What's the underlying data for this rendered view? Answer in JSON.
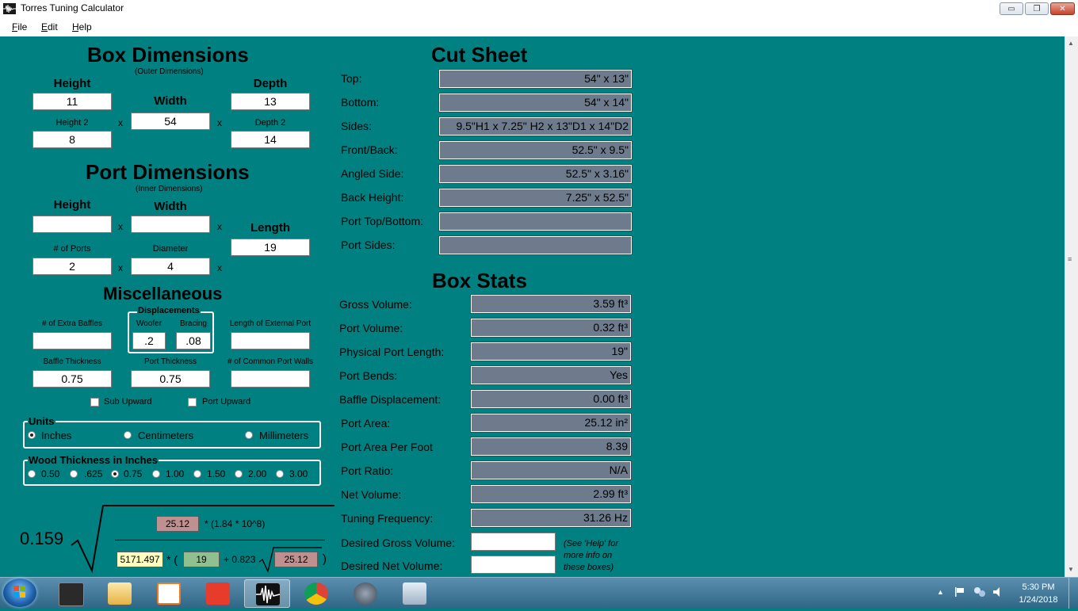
{
  "window": {
    "title": "Torres Tuning Calculator",
    "buttons": {
      "minimize": "▭",
      "maximize": "❐",
      "close": "✕"
    }
  },
  "menu": [
    {
      "label": "File"
    },
    {
      "label": "Edit"
    },
    {
      "label": "Help"
    }
  ],
  "box_dimensions": {
    "heading": "Box Dimensions",
    "subheading": "(Outer Dimensions)",
    "height_label": "Height",
    "height_value": "11",
    "width_label": "Width",
    "width_value": "54",
    "depth_label": "Depth",
    "depth_value": "13",
    "height2_label": "Height 2",
    "height2_value": "8",
    "depth2_label": "Depth 2",
    "depth2_value": "14",
    "times": "x"
  },
  "port_dimensions": {
    "heading": "Port Dimensions",
    "subheading": "(Inner Dimensions)",
    "height_label": "Height",
    "height_value": "",
    "width_label": "Width",
    "width_value": "",
    "length_label": "Length",
    "length_value": "19",
    "num_ports_label": "# of Ports",
    "num_ports_value": "2",
    "diameter_label": "Diameter",
    "diameter_value": "4",
    "times": "x"
  },
  "misc": {
    "heading": "Miscellaneous",
    "extra_baffles_label": "# of Extra Baffles",
    "extra_baffles_value": "",
    "displacements_label": "Displacements",
    "woofer_label": "Woofer",
    "woofer_value": ".2",
    "bracing_label": "Bracing",
    "bracing_value": ".08",
    "external_port_label": "Length of External Port",
    "external_port_value": "",
    "baffle_thickness_label": "Baffle Thickness",
    "baffle_thickness_value": "0.75",
    "port_thickness_label": "Port Thickness",
    "port_thickness_value": "0.75",
    "common_walls_label": "# of Common Port Walls",
    "common_walls_value": "",
    "sub_upward_label": "Sub Upward",
    "sub_upward_checked": false,
    "port_upward_label": "Port Upward",
    "port_upward_checked": false
  },
  "units": {
    "legend": "Units",
    "options": [
      "Inches",
      "Centimeters",
      "Millimeters"
    ],
    "selected": "Inches"
  },
  "wood_thickness": {
    "legend": "Wood Thickness in Inches",
    "options": [
      "0.50",
      ".625",
      "0.75",
      "1.00",
      "1.50",
      "2.00",
      "3.00"
    ],
    "selected": "0.75"
  },
  "formula": {
    "constant": "0.159",
    "numerator_value": "25.12",
    "numerator_text": "* (1.84 * 10^8)",
    "denom_value1": "5171.497",
    "denom_times": "* (",
    "denom_value2": "19",
    "denom_plus": "+ 0.823",
    "denom_value3": "25.12",
    "denom_close": ")",
    "colors": {
      "rose": "#c09090",
      "yellow": "#ffffc0",
      "green": "#90c090"
    }
  },
  "cut_sheet": {
    "heading": "Cut Sheet",
    "rows": [
      {
        "label": "Top:",
        "value": "54\" x 13\""
      },
      {
        "label": "Bottom:",
        "value": "54\" x 14\""
      },
      {
        "label": "Sides:",
        "value": "9.5\"H1 x 7.25\" H2 x 13\"D1 x 14\"D2"
      },
      {
        "label": "Front/Back:",
        "value": "52.5\" x 9.5\""
      },
      {
        "label": "Angled Side:",
        "value": "52.5\" x 3.16\""
      },
      {
        "label": "Back Height:",
        "value": "7.25\" x 52.5\""
      },
      {
        "label": "Port Top/Bottom:",
        "value": ""
      },
      {
        "label": "Port Sides:",
        "value": ""
      }
    ]
  },
  "box_stats": {
    "heading": "Box Stats",
    "rows": [
      {
        "label": "Gross Volume:",
        "value": "3.59 ft³"
      },
      {
        "label": "Port Volume:",
        "value": "0.32 ft³"
      },
      {
        "label": "Physical Port Length:",
        "value": "19\""
      },
      {
        "label": "Port Bends:",
        "value": "Yes"
      },
      {
        "label": "Baffle Displacement:",
        "value": "0.00 ft³"
      },
      {
        "label": "Port Area:",
        "value": "25.12 in²"
      },
      {
        "label": "Port Area Per Foot",
        "value": "8.39"
      },
      {
        "label": "Port Ratio:",
        "value": "N/A"
      },
      {
        "label": "Net Volume:",
        "value": "2.99 ft³"
      },
      {
        "label": "Tuning Frequency:",
        "value": "31.26 Hz"
      }
    ],
    "desired_gross_label": "Desired Gross Volume:",
    "desired_gross_value": "",
    "desired_net_label": "Desired Net Volume:",
    "desired_net_value": "",
    "help_note": [
      "(See 'Help' for",
      "more info on",
      "these boxes)"
    ]
  },
  "taskbar": {
    "time": "5:30 PM",
    "date": "1/24/2018",
    "tray_arrow": "▲",
    "apps": [
      "start-orb",
      "app-media-manager",
      "app-file-explorer",
      "app-media-player",
      "app-sketchup",
      "app-torres-tuning",
      "app-chrome",
      "app-winisd",
      "app-camera"
    ]
  }
}
